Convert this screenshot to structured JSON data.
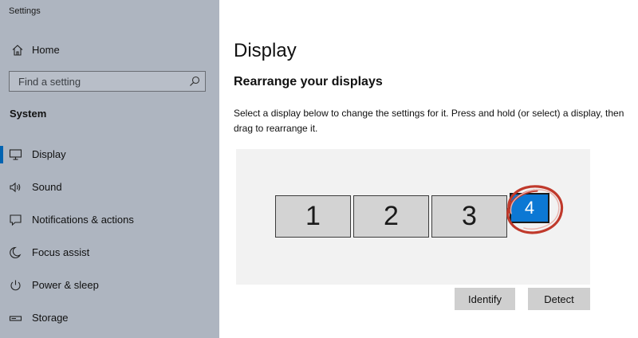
{
  "window": {
    "title": "Settings"
  },
  "sidebar": {
    "home_label": "Home",
    "search_placeholder": "Find a setting",
    "section": "System",
    "items": [
      {
        "label": "Display",
        "icon": "monitor-icon",
        "selected": true
      },
      {
        "label": "Sound",
        "icon": "speaker-icon"
      },
      {
        "label": "Notifications & actions",
        "icon": "notification-icon"
      },
      {
        "label": "Focus assist",
        "icon": "moon-icon"
      },
      {
        "label": "Power & sleep",
        "icon": "power-icon"
      },
      {
        "label": "Storage",
        "icon": "storage-icon"
      }
    ]
  },
  "main": {
    "title": "Display",
    "subtitle": "Rearrange your displays",
    "description": "Select a display below to change the settings for it. Press and hold (or select) a display, then drag to rearrange it.",
    "monitors": [
      {
        "label": "1"
      },
      {
        "label": "2"
      },
      {
        "label": "3"
      },
      {
        "label": "4",
        "selected": true
      }
    ],
    "buttons": {
      "identify": "Identify",
      "detect": "Detect"
    }
  },
  "colors": {
    "sidebar_bg": "#aeb5c0",
    "accent": "#0c78d4",
    "highlight_circle": "#c0392b",
    "panel_bg": "#f2f2f2"
  }
}
